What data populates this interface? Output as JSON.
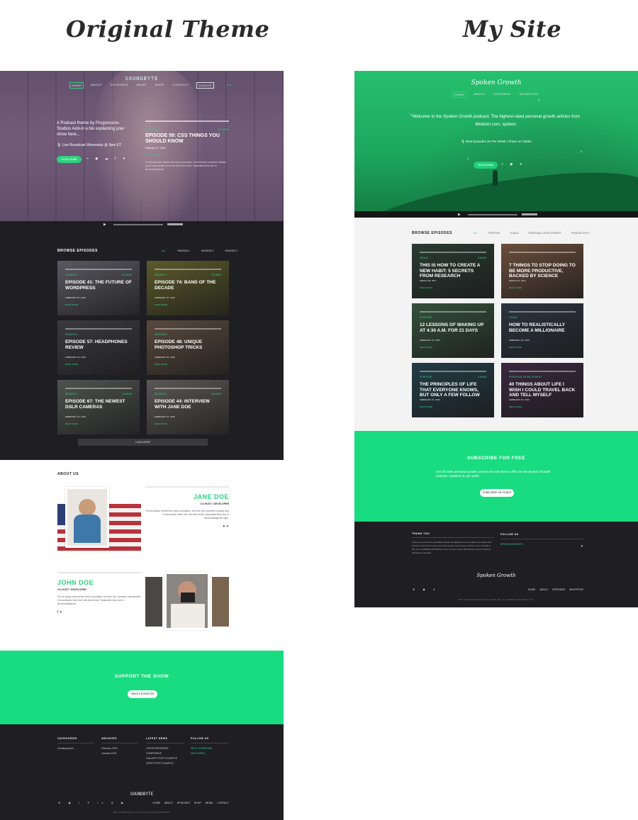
{
  "headings": {
    "original": "Original Theme",
    "mine": "My Site"
  },
  "original": {
    "hero": {
      "logo": "SOUNDBYTE",
      "nav": [
        "HOME",
        "ABOUT",
        "EPISODES",
        "NEWS",
        "SHOP",
        "CONTACT",
        "DONATE"
      ],
      "intro": "A Podcast theme by Progression-Studios Add-in a bio explaining your show here...",
      "live": "Live Broadcast Wenesday @ 9pm ET",
      "subscribe": "SUBSCRIBE",
      "episode": {
        "season": "SEASON 3",
        "mins": "33 MINS",
        "title": "EPISODE 59: CSS THINGS YOU SHOULD KNOW",
        "date": "February 07, 2016",
        "more": "READ MORE",
        "desc": "In this episode, behind the word mountains, far from the countries Vokalia and Consonantia, there live the blind texts. Separated they live in Bookmarksgrove."
      }
    },
    "browse": {
      "title": "BROWSE EPISODES",
      "tabs": [
        "ALL",
        "SEASON 1",
        "SEASON 2",
        "SEASON 3"
      ],
      "tiles": [
        {
          "season": "SEASON 2",
          "mins": "33 MINS",
          "title": "EPISODE 41: THE FUTURE OF WORDPRESS",
          "date": "FEBRUARY 07, 2016",
          "more": "READ MORE",
          "color": "#5a5860"
        },
        {
          "season": "SEASON 2",
          "mins": "33 MINS",
          "title": "EPISODE 74: BAND OF THE DECADE",
          "date": "FEBRUARY 07, 2016",
          "more": "READ MORE",
          "color": "#5b5a2a"
        },
        {
          "season": "SEASON 2",
          "mins": "",
          "title": "EPISODE 57: HEADPHONES REVIEW",
          "date": "FEBRUARY 07, 2016",
          "more": "READ MORE",
          "color": "#3b3a3f"
        },
        {
          "season": "SEASON 3",
          "mins": "",
          "title": "EPISODE 48: UNIQUE PHOTOSHOP TRICKS",
          "date": "FEBRUARY 07, 2016",
          "more": "READ MORE",
          "color": "#5a4a3e"
        },
        {
          "season": "SEASON 1",
          "mins": "33 MINS",
          "title": "EPISODE 67: THE NEWEST DSLR CAMERAS",
          "date": "FEBRUARY 07, 2016",
          "more": "READ MORE",
          "color": "#4f5350"
        },
        {
          "season": "SEASON 1",
          "mins": "33 MINS",
          "title": "EPISODE 44: INTERVIEW WITH JANE DOE",
          "date": "FEBRUARY 07, 2016",
          "more": "READ MORE",
          "color": "#5c5756"
        }
      ],
      "load_more": "LOAD MORE"
    },
    "about": {
      "title": "ABOUT US",
      "jane": {
        "name": "JANE DOE",
        "role": "CO-HOST / DEVELOPER",
        "bio": "Far far away, behind the word mountains, far from the countries Vokalia and Consonantia, there live the blind texts. Separated they live in Bookmarksgrove right."
      },
      "john": {
        "name": "JOHN DOE",
        "role": "CO-HOST / DEVELOPER",
        "bio": "Far far away, behind the word mountains, far from the countries Vokalia and Consonantia, there live the blind texts. Separated they live in Bookmarksgrove."
      }
    },
    "support": {
      "title": "SUPPORT THE SHOW",
      "button": "MAKE A DONATION"
    },
    "footer": {
      "categories": {
        "title": "CATEGORIES",
        "items": [
          "Uncategorized"
        ]
      },
      "archives": {
        "title": "ARCHIVES",
        "items": [
          "February 2016",
          "January 2016"
        ]
      },
      "latest": {
        "title": "LATEST NEWS",
        "items": [
          "CROSS BROWSER COMPATIBLE",
          "GALLERY POST EXAMPLE",
          "VIDEO POST EXAMPLE"
        ]
      },
      "follow": {
        "title": "FOLLOW US",
        "items": [
          "NELA THOMPSON",
          "DAN JONES"
        ]
      },
      "logo": "SOUNDBYTE",
      "links": [
        "HOME",
        "ABOUT",
        "EPISODES",
        "SHOP",
        "NEWS",
        "CONTACT"
      ],
      "copyright": "2017 All Rights Reserved. Developed by ProgressionStudios"
    }
  },
  "mine": {
    "hero": {
      "logo": "Spoken Growth",
      "nav": [
        "HOME",
        "ABOUT",
        "EPISODES",
        "ADVERTISE"
      ],
      "intro": "Welcome to the Spoken Growth podcast. The highest-rated personal growth articles from Medium.com, spoken.",
      "line": "New Episodes 3X Per Week / Share on Twitter",
      "subscribe": "SUBSCRIBE"
    },
    "browse": {
      "title": "BROWSE EPISODES",
      "tabs": [
        "ALL",
        "PURPOSE",
        "GOALS",
        "PERSONAL DEVELOPMENT",
        "PRODUCTIVITY"
      ],
      "tiles": [
        {
          "season": "GOALS",
          "mins": "5 MINS",
          "title": "THIS IS HOW TO CREATE A NEW HABIT: 5 SECRETS FROM RESEARCH",
          "date": "MARCH 09, 2017",
          "more": "READ MORE",
          "color": "#2a3a33"
        },
        {
          "season": "",
          "mins": "",
          "title": "7 THINGS TO STOP DOING TO BE MORE PRODUCTIVE, BACKED BY SCIENCE",
          "date": "MARCH 07, 2016",
          "more": "READ MORE",
          "color": "#6b4e3c"
        },
        {
          "season": "PURPOSE",
          "mins": "",
          "title": "12 LESSONS OF WAKING UP AT 4:30 A.M. FOR 21 DAYS",
          "date": "FEBRUARY 07, 2016",
          "more": "READ MORE",
          "color": "#35503a"
        },
        {
          "season": "GOALS",
          "mins": "",
          "title": "HOW TO REALISTICALLY BECOME A MILLIONAIRE",
          "date": "FEBRUARY 07, 2016",
          "more": "READ MORE",
          "color": "#2c3440"
        },
        {
          "season": "PURPOSE",
          "mins": "5 MINS",
          "title": "THE PRINCIPLES OF LIFE THAT EVERYONE KNOWS, BUT ONLY A FEW FOLLOW",
          "date": "FEBRUARY 07, 2016",
          "more": "READ MORE",
          "color": "#233c46"
        },
        {
          "season": "PERSONAL DEVELOPMENT",
          "mins": "",
          "title": "40 THINGS ABOUT LIFE I WISH I COULD TRAVEL BACK AND TELL MYSELF",
          "date": "FEBRUARY 07, 2016",
          "more": "READ MORE",
          "color": "#3a2840"
        }
      ]
    },
    "subscribe": {
      "title": "SUBSCRIBE FOR FREE",
      "text": "Get the best personal growth content the web has to offer via the Spoken Growth podcast. Updated 3x per week.",
      "button": "SUBSCRIBE ON ITUNES"
    },
    "footer": {
      "thank": {
        "title": "THANK YOU",
        "text": "Thank you to all of the incredible authors on Medium.com who allow us to share their content. If you'd like to see your work spoken, let us know, we'll be sure to include it. We are not affiliated with Medium.com, and we ensure that authors receive credit by sharing any episode."
      },
      "follow": {
        "title": "FOLLOW US",
        "items": [
          "SPOKEN GROWTH"
        ]
      },
      "logo": "Spoken Growth",
      "links": [
        "HOME",
        "ABOUT",
        "EPISODES",
        "ADVERTISE"
      ],
      "copyright": "2017 All rights reserved. Spoken Growth. We are not affiliated with Medium.com."
    }
  },
  "colors": {
    "accent": "#18dc7f",
    "dark": "#1f1e22",
    "purple": "#5e4a68"
  }
}
